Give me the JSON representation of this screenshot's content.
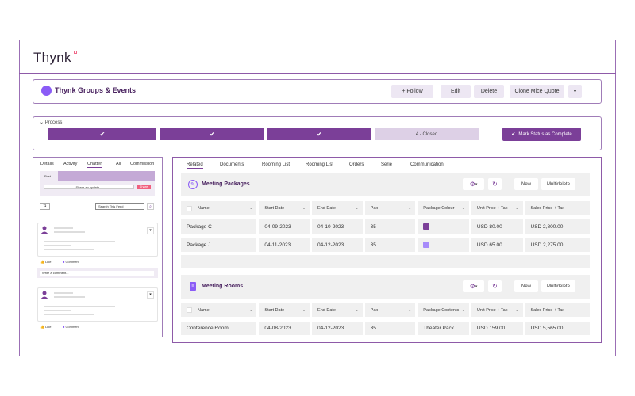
{
  "app": {
    "logo": "Thynk"
  },
  "record": {
    "title": "Thynk Groups & Events",
    "buttons": {
      "follow": "+ Follow",
      "edit": "Edit",
      "delete": "Delete",
      "clone": "Clone Mice Quote"
    }
  },
  "process": {
    "label": "Process",
    "stages": [
      "✔",
      "✔",
      "✔",
      "4 - Closed"
    ],
    "mark_complete": "Mark Status as Complete"
  },
  "left_panel": {
    "tabs": [
      "Details",
      "Activity",
      "Chatter",
      "All",
      "Commission"
    ],
    "active_tab": "Chatter",
    "post_tab": "Post",
    "share_placeholder": "Share an update...",
    "share_button": "Share",
    "search_placeholder": "Search This Feed",
    "like": "Like",
    "comment": "Comment",
    "write_comment": "Write a comment..."
  },
  "right_panel": {
    "tabs": [
      "Related",
      "Documents",
      "Rooming List",
      "Rooming List",
      "Orders",
      "Serie",
      "Communication"
    ],
    "active_tab": "Related",
    "new_label": "New",
    "multidelete_label": "Multidelete",
    "packages": {
      "title": "Meeting Packages",
      "columns": [
        "Name",
        "Start Date",
        "End Date",
        "Pax",
        "Package Colour",
        "Unit Price + Tax",
        "Sales Price + Tax"
      ],
      "rows": [
        {
          "name": "Package C",
          "start": "04-09-2023",
          "end": "04-10-2023",
          "pax": "35",
          "colour": "#7b3f98",
          "unit": "USD 80.00",
          "sales": "USD 2,800.00"
        },
        {
          "name": "Package J",
          "start": "04-11-2023",
          "end": "04-12-2023",
          "pax": "35",
          "colour": "#a78bfa",
          "unit": "USD 65.00",
          "sales": "USD 2,275.00"
        }
      ]
    },
    "rooms": {
      "title": "Meeting Rooms",
      "columns": [
        "Name",
        "Start Date",
        "End Date",
        "Pax",
        "Package Contents",
        "Unit Price + Tax",
        "Sales Price + Tax"
      ],
      "rows": [
        {
          "name": "Conference Room",
          "start": "04-08-2023",
          "end": "04-12-2023",
          "pax": "35",
          "contents": "Theater Pack",
          "unit": "USD 159.00",
          "sales": "USD 5,565.00"
        }
      ]
    }
  }
}
